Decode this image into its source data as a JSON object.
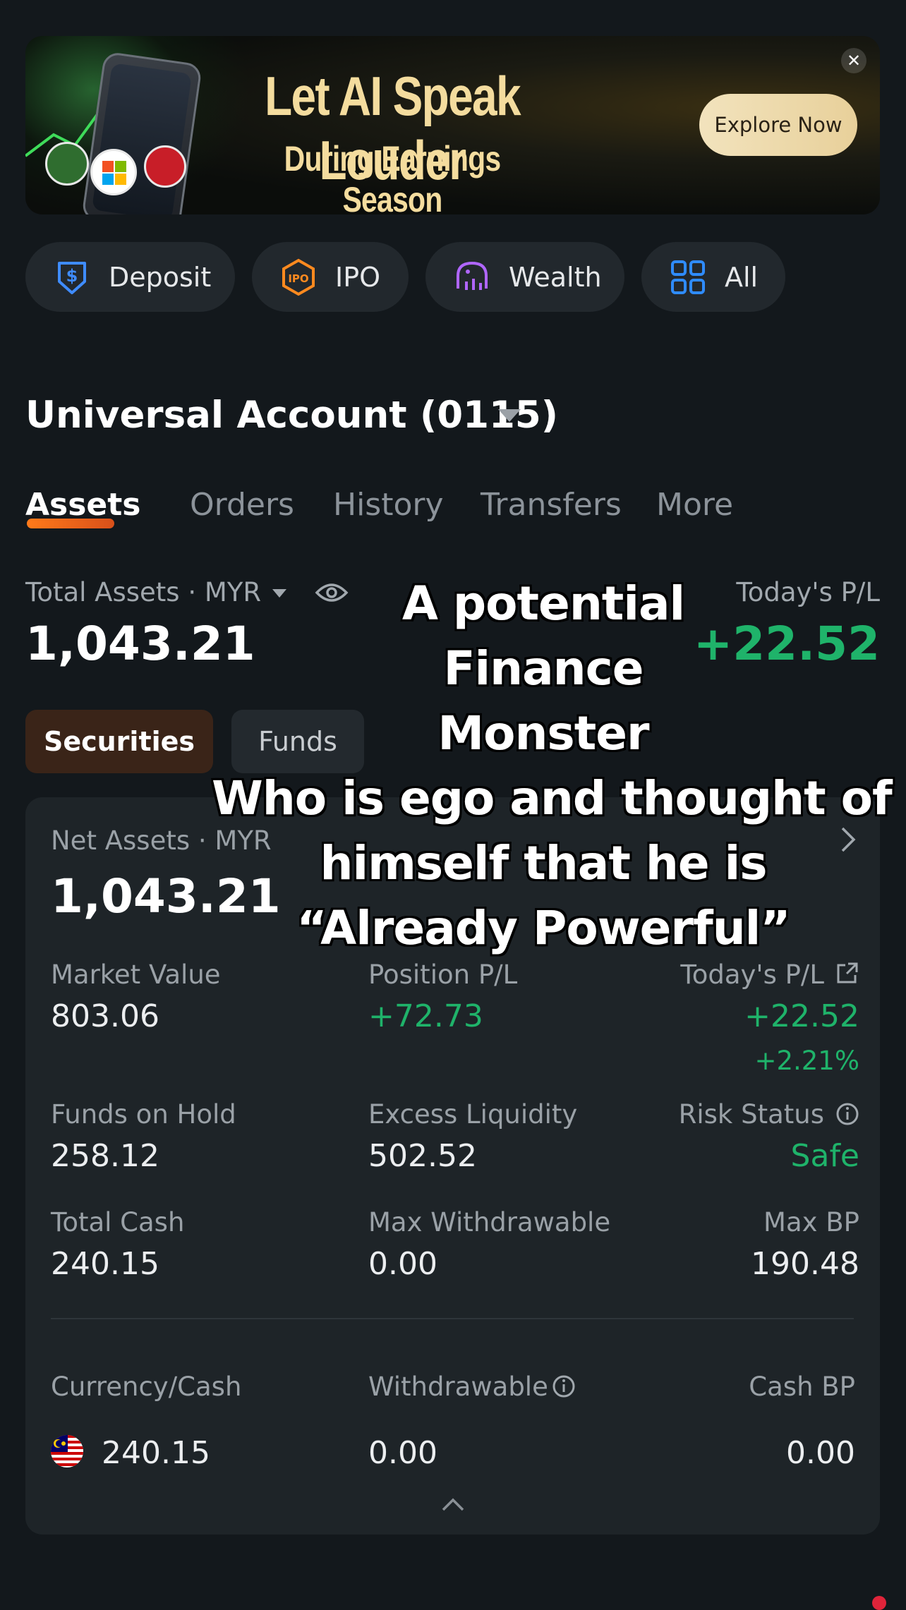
{
  "banner": {
    "title": "Let AI Speak Louder",
    "subtitle": "During Earnings Season",
    "cta": "Explore Now",
    "close_symbol": "✕"
  },
  "quick_actions": [
    {
      "label": "Deposit",
      "icon": "deposit-icon"
    },
    {
      "label": "IPO",
      "icon": "ipo-icon"
    },
    {
      "label": "Wealth",
      "icon": "wealth-icon"
    },
    {
      "label": "All",
      "icon": "grid-icon"
    }
  ],
  "account": {
    "title": "Universal Account (0115)"
  },
  "tabs": [
    "Assets",
    "Orders",
    "History",
    "Transfers",
    "More"
  ],
  "summary": {
    "total_label": "Total Assets · MYR",
    "total_value": "1,043.21",
    "pl_label": "Today's P/L",
    "pl_value": "+22.52"
  },
  "segments": {
    "securities": "Securities",
    "funds": "Funds"
  },
  "card": {
    "net_label": "Net Assets · MYR",
    "net_value": "1,043.21",
    "market_value_label": "Market Value",
    "market_value": "803.06",
    "position_pl_label": "Position P/L",
    "position_pl": "+72.73",
    "todays_pl_label": "Today's P/L",
    "todays_pl": "+22.52",
    "todays_pl_pct": "+2.21%",
    "funds_on_hold_label": "Funds on Hold",
    "funds_on_hold": "258.12",
    "excess_liquidity_label": "Excess Liquidity",
    "excess_liquidity": "502.52",
    "risk_status_label": "Risk Status",
    "risk_status": "Safe",
    "total_cash_label": "Total Cash",
    "total_cash": "240.15",
    "max_withdrawable_label": "Max Withdrawable",
    "max_withdrawable": "0.00",
    "max_bp_label": "Max BP",
    "max_bp": "190.48",
    "currency_cash_label": "Currency/Cash",
    "withdrawable_label": "Withdrawable",
    "cash_bp_label": "Cash BP",
    "currency_cash": "240.15",
    "withdrawable": "0.00",
    "cash_bp": "0.00"
  },
  "overlay_caption": [
    "A potential",
    "Finance",
    "Monster",
    "Who is ego and thought of",
    "himself that he is",
    "“Already Powerful”"
  ],
  "colors": {
    "background": "#13181c",
    "card": "#1e2428",
    "positive": "#1fb36a",
    "accent_orange": "#ff7a1a",
    "banner_gold": "#f4dc9e"
  }
}
